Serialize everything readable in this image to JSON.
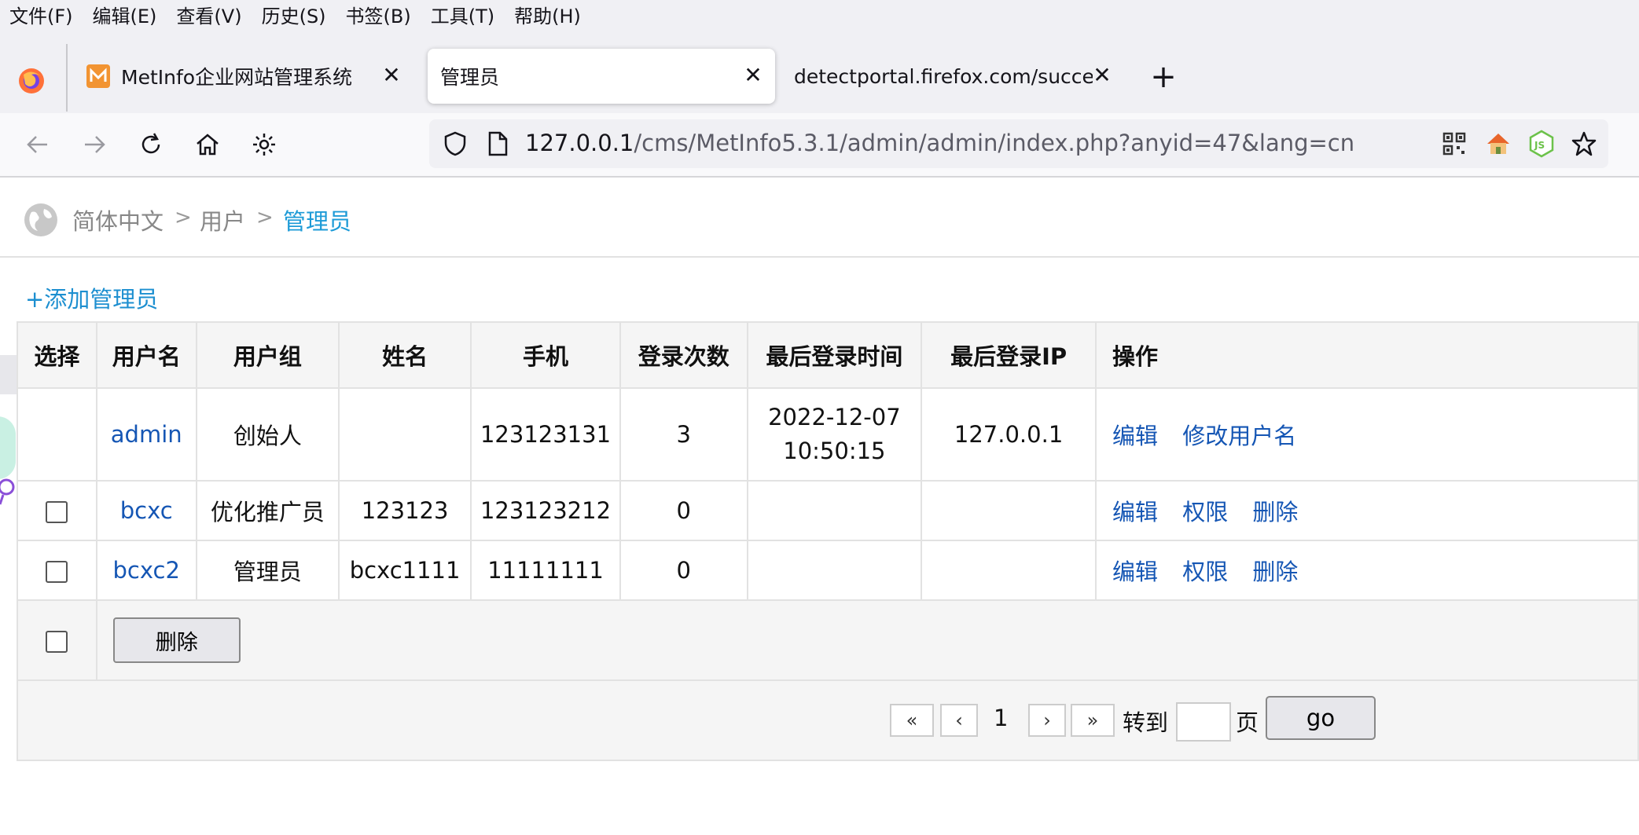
{
  "menubar": {
    "items": [
      "文件(F)",
      "编辑(E)",
      "查看(V)",
      "历史(S)",
      "书签(B)",
      "工具(T)",
      "帮助(H)"
    ]
  },
  "tabs": [
    {
      "title": "MetInfo企业网站管理系统",
      "close": "✕"
    },
    {
      "title": "管理员",
      "close": "✕"
    },
    {
      "title": "detectportal.firefox.com/success.t",
      "close": "✕"
    }
  ],
  "new_tab": "+",
  "urlbar": {
    "host": "127.0.0.1",
    "path": "/cms/MetInfo5.3.1/admin/admin/index.php?anyid=47&lang=cn"
  },
  "breadcrumb": {
    "items": [
      "简体中文",
      "用户",
      "管理员"
    ],
    "separator": ">",
    "active_color": "#1d9bd7"
  },
  "add_admin_label": "+添加管理员",
  "table": {
    "headers": [
      "选择",
      "用户名",
      "用户组",
      "姓名",
      "手机",
      "登录次数",
      "最后登录时间",
      "最后登录IP",
      "操作"
    ],
    "rows": [
      {
        "checkbox": false,
        "username": "admin",
        "group": "创始人",
        "name": "",
        "phone": "123123131",
        "logins": "3",
        "last_login_date": "2022-12-07",
        "last_login_time": "10:50:15",
        "last_ip": "127.0.0.1",
        "actions": [
          "编辑",
          "修改用户名"
        ]
      },
      {
        "checkbox": true,
        "username": "bcxc",
        "group": "优化推广员",
        "name": "123123",
        "phone": "123123212",
        "logins": "0",
        "last_login_date": "",
        "last_login_time": "",
        "last_ip": "",
        "actions": [
          "编辑",
          "权限",
          "删除"
        ]
      },
      {
        "checkbox": true,
        "username": "bcxc2",
        "group": "管理员",
        "name": "bcxc1111",
        "phone": "11111111",
        "logins": "0",
        "last_login_date": "",
        "last_login_time": "",
        "last_ip": "",
        "actions": [
          "编辑",
          "权限",
          "删除"
        ]
      }
    ],
    "delete_button": "删除"
  },
  "pager": {
    "first": "«",
    "prev": "‹",
    "current_page": "1",
    "next": "›",
    "last": "»",
    "goto_label": "转到",
    "page_label": "页",
    "go_button": "go"
  },
  "colors": {
    "link_blue": "#1556b4",
    "add_link": "#1d8fd0",
    "brand_orange": "#f29432"
  }
}
